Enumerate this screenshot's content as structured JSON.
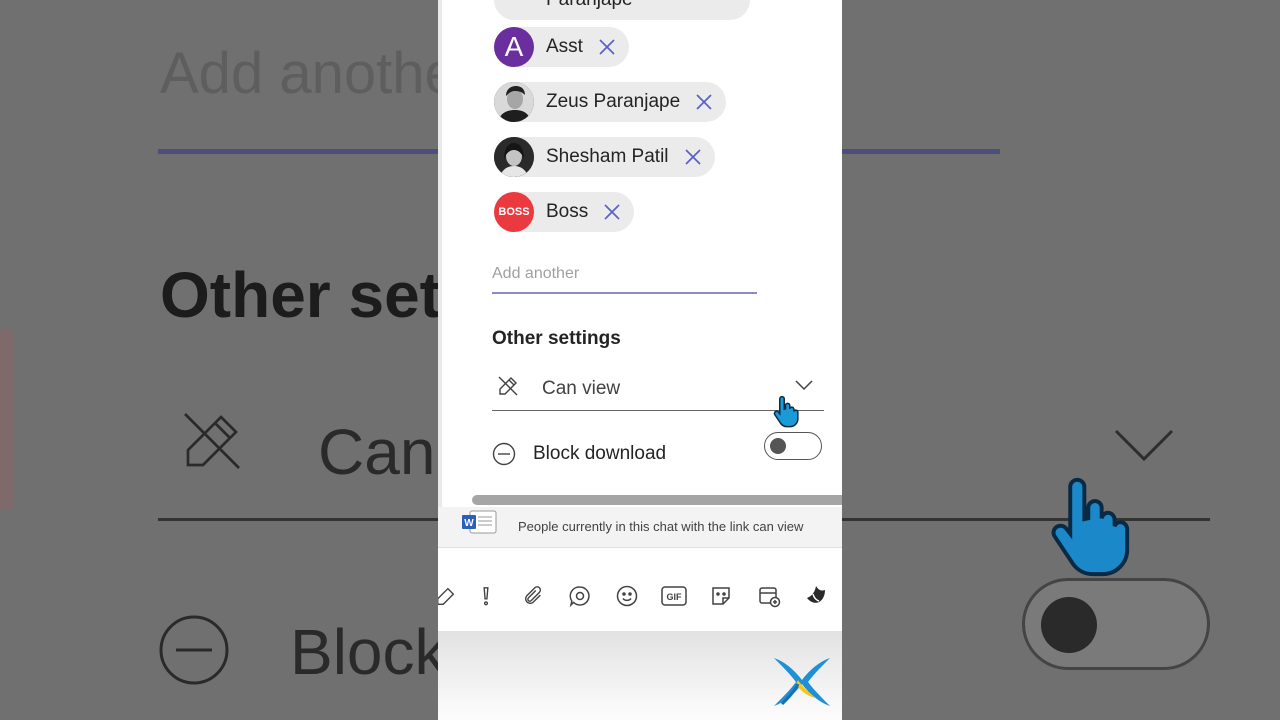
{
  "background": {
    "add_text": "Add anothe",
    "other_text": "Other set",
    "can_text": "Can",
    "block_text": "Block"
  },
  "share": {
    "partial_top_name": "Paranjape",
    "people": [
      {
        "name": "Asst",
        "avatar": "A",
        "avatar_color": "#6a2e9e"
      },
      {
        "name": "Zeus Paranjape",
        "avatar": "",
        "avatar_color": "#2b2b2b"
      },
      {
        "name": "Shesham Patil",
        "avatar": "",
        "avatar_color": "#3a3a3a"
      },
      {
        "name": "Boss",
        "avatar": "BOSS",
        "avatar_color": "#ea3a3f"
      }
    ],
    "add_placeholder": "Add another",
    "other_settings_title": "Other settings",
    "permission": "Can view",
    "block_download_label": "Block download",
    "block_download_on": false
  },
  "chat": {
    "info_text": "People currently in this chat with the link can view",
    "toolbar_icons": [
      "format-icon",
      "important-icon",
      "attach-icon",
      "loop-icon",
      "emoji-icon",
      "gif-icon",
      "sticker-icon",
      "schedule-meeting-icon",
      "app-icon"
    ]
  },
  "colors": {
    "accent": "#6264a7",
    "x_icon": "#5b5fc7"
  }
}
